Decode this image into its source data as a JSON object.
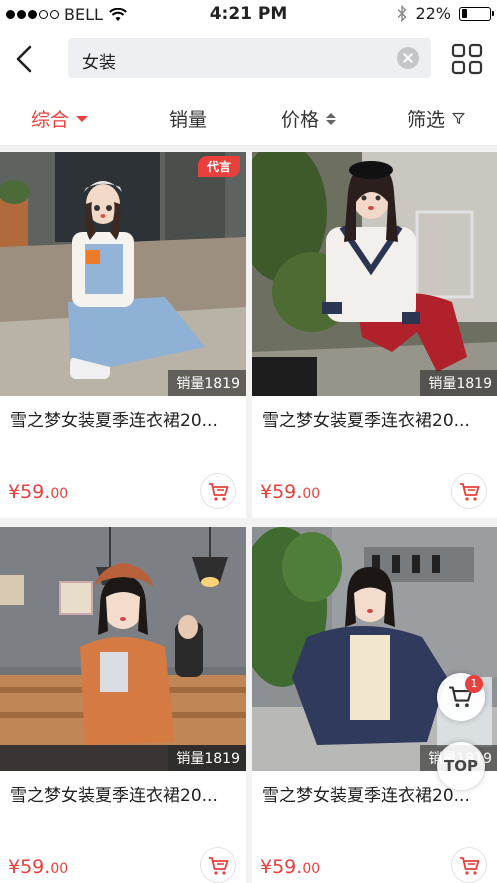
{
  "status_bar": {
    "carrier": "BELL",
    "time": "4:21 PM",
    "battery": "22%",
    "battery_level": 0.22
  },
  "search": {
    "query": "女装"
  },
  "sort_tabs": [
    {
      "label": "综合",
      "active": true
    },
    {
      "label": "销量"
    },
    {
      "label": "价格"
    },
    {
      "label": "筛选"
    }
  ],
  "products": [
    {
      "title": "雪之梦女装夏季连衣裙20...",
      "price_main": "¥59.",
      "price_cents": "00",
      "sales": "销量1819",
      "promo": "代言"
    },
    {
      "title": "雪之梦女装夏季连衣裙20...",
      "price_main": "¥59.",
      "price_cents": "00",
      "sales": "销量1819"
    },
    {
      "title": "雪之梦女装夏季连衣裙20...",
      "price_main": "¥59.",
      "price_cents": "00",
      "sales": "销量1819"
    },
    {
      "title": "雪之梦女装夏季连衣裙20...",
      "price_main": "¥59.",
      "price_cents": "00",
      "sales": "销量1819"
    }
  ],
  "floating": {
    "cart_badge": "1",
    "top_label": "TOP"
  },
  "colors": {
    "accent": "#e8413d"
  }
}
